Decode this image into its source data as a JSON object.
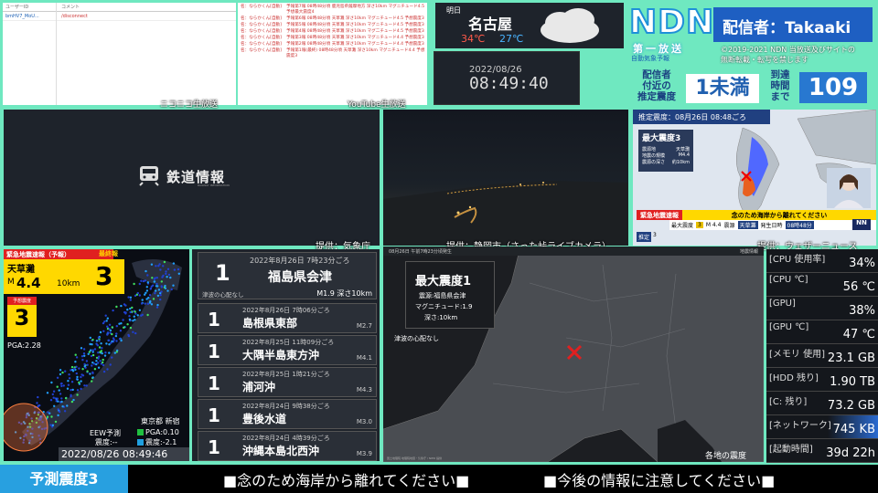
{
  "comments_left": {
    "headers": [
      "ユーザーID",
      "コメント"
    ],
    "rows": [
      {
        "user": "bmHV7_MoU...",
        "comment": "/disconnect"
      }
    ],
    "source": "ニコニコ生放送"
  },
  "comments_right": {
    "rows": [
      {
        "user": "名：ならかくん[自動]",
        "text": "予報第7報 08時48分頃 鹿児島県薩摩地方 深さ10km マグニチュード4.5 予想最大震度4"
      },
      {
        "user": "名：ならかくん[自動]",
        "text": "予報第6報 08時48分頃 天草灘 深さ10km マグニチュード4.5 予想震度3"
      },
      {
        "user": "名：ならかくん[自動]",
        "text": "予報第5報 08時48分頃 天草灘 深さ10km マグニチュード4.5 予想震度3"
      },
      {
        "user": "名：ならかくん[自動]",
        "text": "予報第4報 08時48分頃 天草灘 深さ10km マグ二チュード4.5 予想震度3"
      },
      {
        "user": "名：ならかくん[自動]",
        "text": "予報第3報 08時48分頃 天草灘 深さ10km マグニチュード4.4 予想震度3"
      },
      {
        "user": "名：ならかくん[自動]",
        "text": "予報第2報 08時48分頃 天草灘 深さ10km マグニチュード4.4 予想震度3"
      },
      {
        "user": "名：ならかくん[自動]",
        "text": "予報第1報(最終) 08時48分頃 天草灘 深さ10km マグニチュード4.4 予想震度3"
      }
    ],
    "source": "YouTube生放送"
  },
  "weather": {
    "day": "明日",
    "city": "名古屋",
    "high": "34℃",
    "low": "27℃"
  },
  "clock": {
    "date": "2022/08/26",
    "time": "08:49:40"
  },
  "ndn": {
    "logo": "NDN",
    "sub": "第一放送",
    "sub2": "自動気象予報",
    "streamer": "配信者：Takaaki",
    "copyright": "©2019-2021 NDN 当放送及びサイトの",
    "notice": "無断転載・転写を禁じます",
    "est_label_1": "配信者",
    "est_label_2": "付近の",
    "est_label_3": "推定震度",
    "est_value": "1未満",
    "arrival_label_1": "到達",
    "arrival_label_2": "時間",
    "arrival_label_3": "まで",
    "arrival_value": "109"
  },
  "cams": {
    "tetsudo": {
      "title": "鉄道情報",
      "sub": "RAILWAY INFORMATION",
      "credit": "提供：気象庁"
    },
    "shizuoka": {
      "credit": "提供：静岡市（さった峠ライブカメラ）"
    },
    "weathernews": {
      "credit": "提供：ウェザーニュース",
      "header": "推定震度：08月26日 08:48ごろ",
      "max": "最大震度3",
      "epicenter_label": "震源地",
      "epicenter": "天草灘",
      "mag_label": "地震の規模",
      "mag": "M4.4",
      "depth_label": "震源の深さ",
      "depth": "約10km",
      "alert_title": "緊急地震速報",
      "alert_msg": "念のため海岸から離れてください",
      "bar_max": "最大震度",
      "bar_int": "3",
      "bar_mag": "M 4.4",
      "bar_epi_label": "震源",
      "bar_epi": "天草灘",
      "bar_time_label": "発生日時",
      "bar_time": "08時48分",
      "est": "推定",
      "est_val": "3",
      "logo": "NN"
    }
  },
  "eew": {
    "title": "緊急地震速報（予報）",
    "final": "最終報",
    "region": "天草灘",
    "mag_prefix": "M",
    "mag": "4.4",
    "depth": "10km",
    "intensity": "3",
    "pred_label": "予想震度",
    "pred": "3",
    "pga": "PGA:2.28",
    "eew_pred": "EEW予測",
    "intensity_short": "震度:--",
    "station": "東京都 新宿",
    "pga_station": "PGA:0.10",
    "station_int": "震度:-2.1",
    "timestamp": "2022/08/26 08:49:46"
  },
  "history": {
    "latest": {
      "int": "1",
      "time": "2022年8月26日 7時23分ごろ",
      "place": "福島県会津",
      "tsunami": "津波の心配なし",
      "mag": "M1.9 深さ10km"
    },
    "items": [
      {
        "int": "1",
        "time": "2022年8月26日 7時06分ごろ",
        "place": "島根県東部",
        "mag": "M2.7"
      },
      {
        "int": "1",
        "time": "2022年8月25日 11時09分ごろ",
        "place": "大隅半島東方沖",
        "mag": "M4.1"
      },
      {
        "int": "1",
        "time": "2022年8月25日 1時21分ごろ",
        "place": "浦河沖",
        "mag": "M4.3"
      },
      {
        "int": "1",
        "time": "2022年8月24日 9時38分ごろ",
        "place": "豊後水道",
        "mag": "M3.0"
      },
      {
        "int": "1",
        "time": "2022年8月24日 4時39分ごろ",
        "place": "沖縄本島北西沖",
        "mag": "M3.9"
      }
    ]
  },
  "map": {
    "header_left": "08月26日 午前7時23分頃発生",
    "header_right": "地震情報",
    "max": "最大震度1",
    "epi": "震源:福島県会津",
    "mag": "マグニチュード:1.9",
    "depth": "深さ:10km",
    "tsunami": "津波の心配なし",
    "bottom": "各地の震度",
    "footer": "国土地理院 地理院地図・気象庁 / NIED 提供"
  },
  "sysmon": [
    {
      "label": "[CPU 使用率]",
      "value": "34%"
    },
    {
      "label": "[CPU ℃]",
      "value": "56 ℃"
    },
    {
      "label": "[GPU]",
      "value": "38%"
    },
    {
      "label": "[GPU ℃]",
      "value": "47 ℃"
    },
    {
      "label": "[メモリ 使用]",
      "value": "23.1 GB"
    },
    {
      "label": "[HDD 残り]",
      "value": "1.90 TB"
    },
    {
      "label": "[C: 残り]",
      "value": "73.2 GB"
    },
    {
      "label": "[ネットワーク]",
      "value": "745 KB"
    },
    {
      "label": "[起動時間]",
      "value": "39d 22h"
    }
  ],
  "ticker": {
    "label": "予測震度3",
    "msg1": "■念のため海岸から離れてください■",
    "msg2": "■今後の情報に注意してください■"
  }
}
